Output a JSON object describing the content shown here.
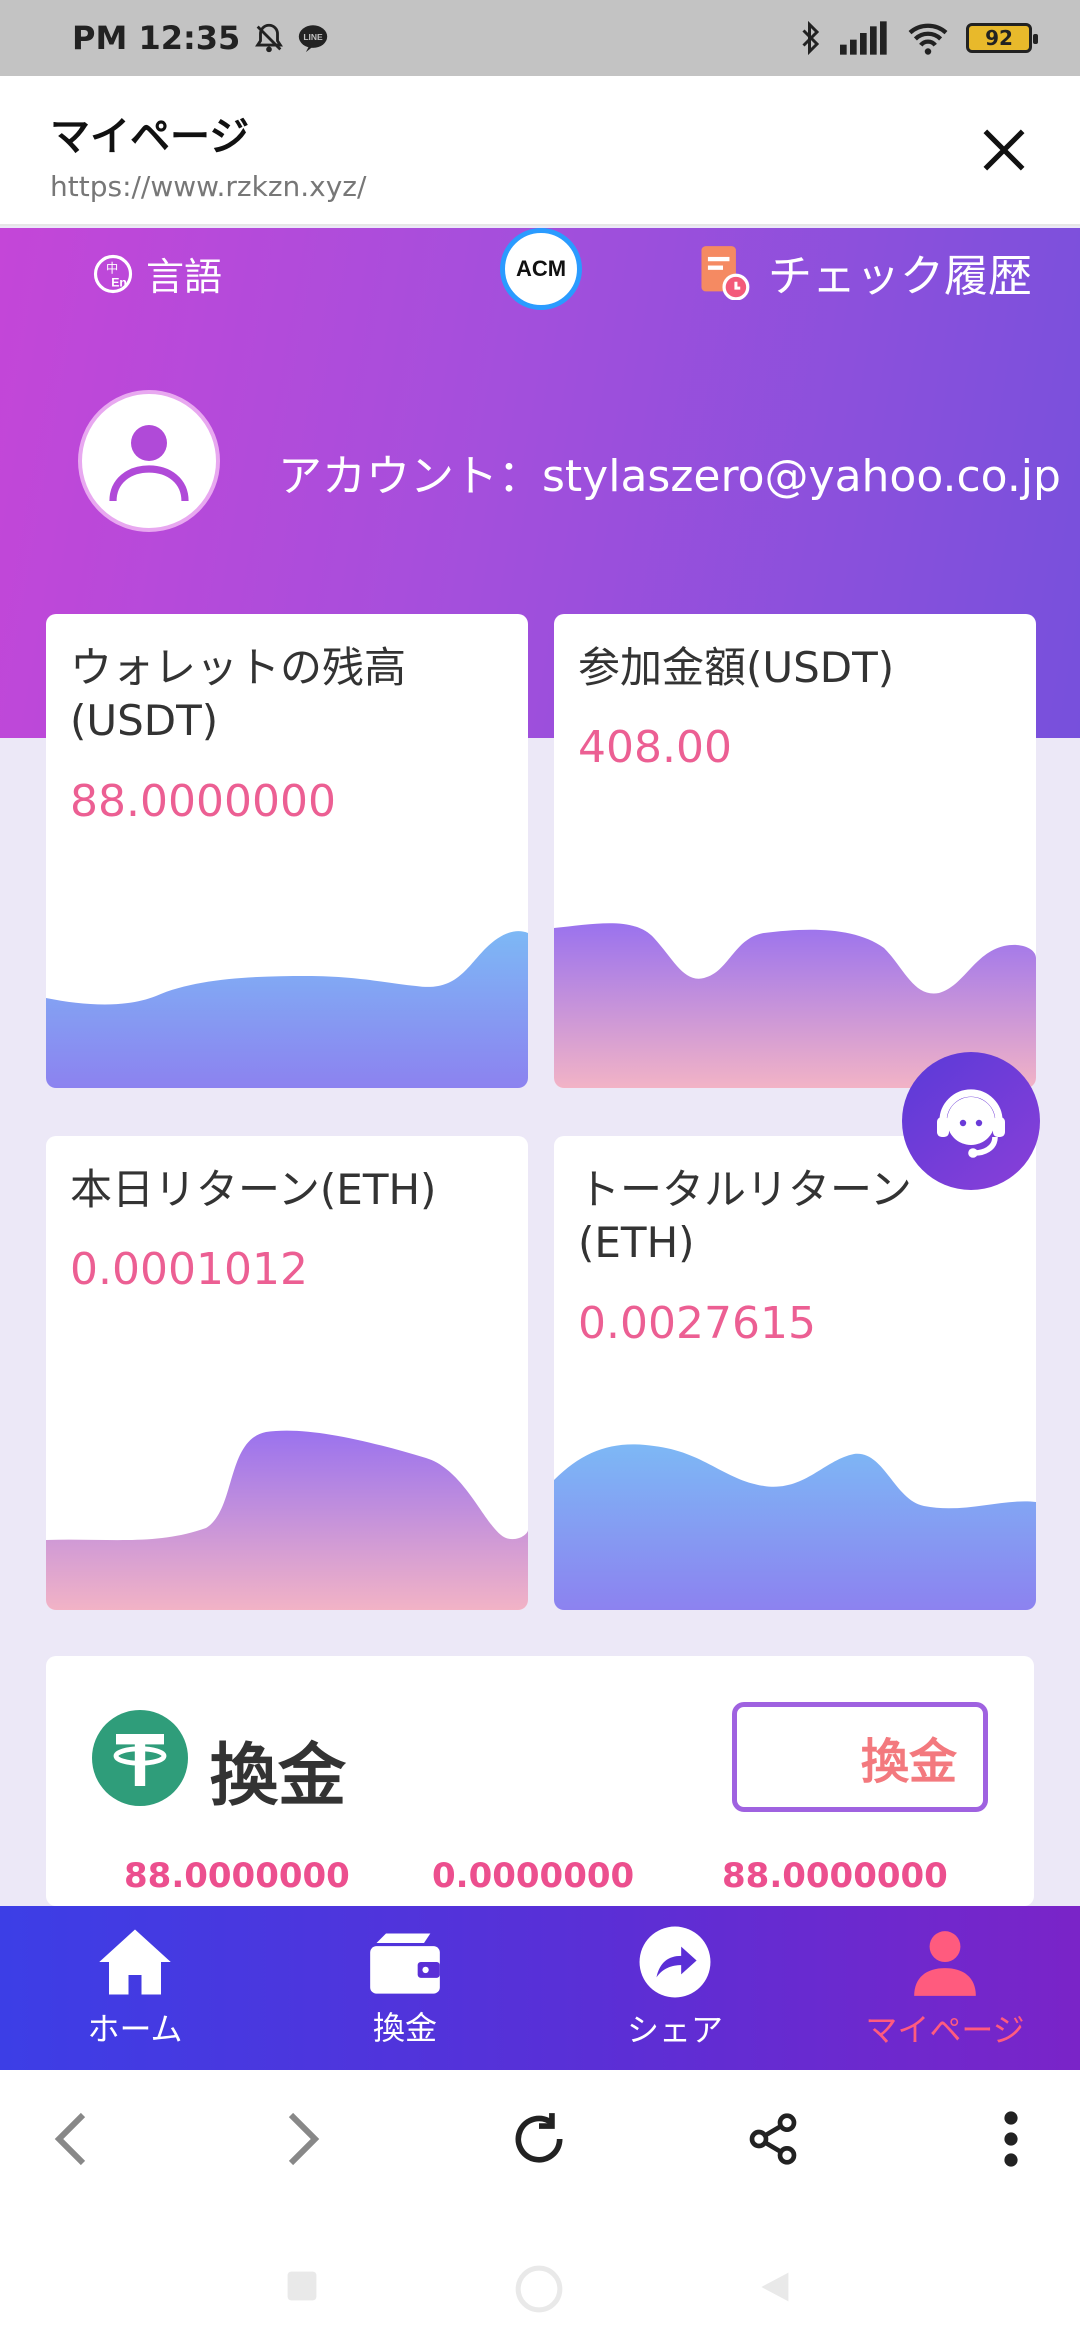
{
  "status_bar": {
    "time": "PM 12:35",
    "battery": "92"
  },
  "browser": {
    "title": "マイページ",
    "url": "https://www.rzkzn.xyz/"
  },
  "hero": {
    "language_label": "言語",
    "logo_text": "ACM",
    "history_label": "チェック履歴",
    "account_text": "アカウント：stylaszero@yahoo.co.jp"
  },
  "cards": [
    {
      "label": "ウォレットの残高(USDT)",
      "value": "88.0000000"
    },
    {
      "label": "参加金額(USDT)",
      "value": "408.00"
    },
    {
      "label": "本日リターン(ETH)",
      "value": "0.0001012"
    },
    {
      "label": "トータルリターン(ETH)",
      "value": "0.0027615"
    }
  ],
  "exchange": {
    "title": "換金",
    "button_label": "換金",
    "values": [
      "88.0000000",
      "0.0000000",
      "88.0000000"
    ]
  },
  "bottom_nav": [
    {
      "label": "ホーム",
      "icon": "home-icon"
    },
    {
      "label": "換金",
      "icon": "wallet-icon"
    },
    {
      "label": "シェア",
      "icon": "share-arrow-icon"
    },
    {
      "label": "マイページ",
      "icon": "user-icon",
      "active": true
    }
  ],
  "colors": {
    "accent_pink": "#ec5f93",
    "hero_start": "#c446d8",
    "hero_end": "#7750dc",
    "active_nav": "#ff5b7e"
  }
}
